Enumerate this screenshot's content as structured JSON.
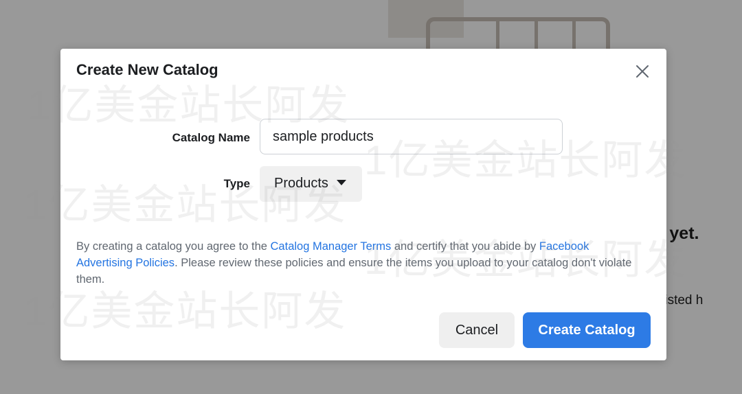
{
  "background": {
    "empty_title_partial": "ogs yet.",
    "empty_desc_partial": "ll be listed h"
  },
  "modal": {
    "title": "Create New Catalog",
    "close_icon": "close-icon",
    "catalog_name_label": "Catalog Name",
    "catalog_name_value": "sample products",
    "type_label": "Type",
    "type_value": "Products",
    "terms": {
      "prefix": "By creating a catalog you agree to the ",
      "link1": "Catalog Manager Terms",
      "middle": " and certify that you abide by ",
      "link2": "Facebook Advertising Policies",
      "suffix": ". Please review these policies and ensure the items you upload to your catalog don't violate them."
    },
    "cancel_label": "Cancel",
    "create_label": "Create Catalog",
    "accent_color": "#2d7be5"
  },
  "watermark": "1亿美金站长阿发"
}
